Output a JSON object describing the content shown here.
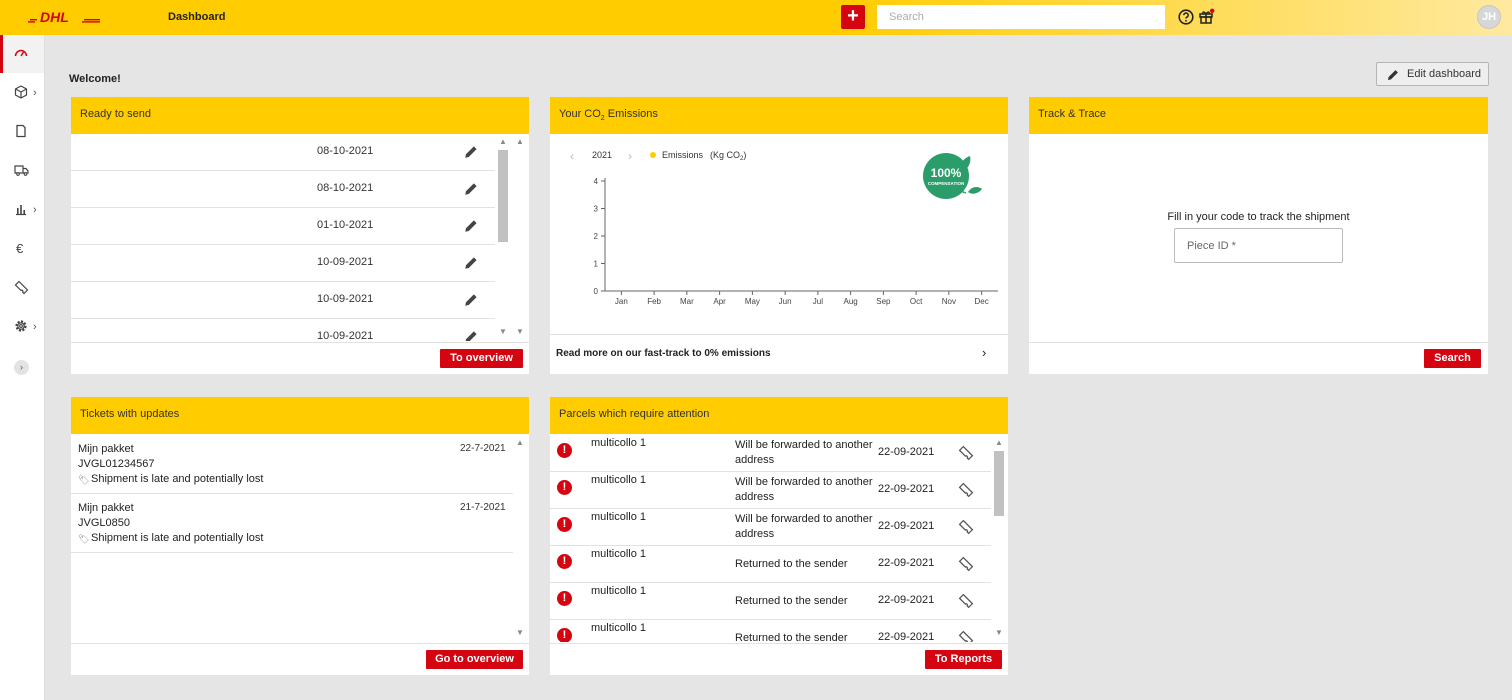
{
  "header": {
    "brand": "DHL",
    "page_title": "Dashboard",
    "search_placeholder": "Search",
    "avatar_initials": "JH",
    "accent_color": "#ffcc00",
    "brand_red": "#d40511"
  },
  "sidebar": {
    "items": [
      {
        "icon": "dashboard-icon",
        "has_chevron": false,
        "active": true
      },
      {
        "icon": "package-icon",
        "has_chevron": true
      },
      {
        "icon": "document-icon",
        "has_chevron": false
      },
      {
        "icon": "truck-icon",
        "has_chevron": false
      },
      {
        "icon": "bar-chart-icon",
        "has_chevron": true
      },
      {
        "icon": "euro-icon",
        "has_chevron": false
      },
      {
        "icon": "ticket-icon",
        "has_chevron": false
      },
      {
        "icon": "gear-icon",
        "has_chevron": true
      }
    ]
  },
  "welcome": "Welcome!",
  "edit_dashboard": "Edit dashboard",
  "ready_to_send": {
    "title": "Ready to send",
    "rows": [
      "08-10-2021",
      "08-10-2021",
      "01-10-2021",
      "10-09-2021",
      "10-09-2021",
      "10-09-2021"
    ],
    "button": "To overview"
  },
  "co2": {
    "title_pre": "Your CO",
    "title_sub": "2",
    "title_post": " Emissions",
    "year": "2021",
    "legend_label": "Emissions",
    "legend_unit_pre": "(Kg CO",
    "legend_unit_sub": "2",
    "legend_unit_post": ")",
    "badge_big": "100%",
    "badge_small": "COMPENSATION",
    "link": "Read more on our fast-track to 0% emissions"
  },
  "chart_data": {
    "type": "line",
    "categories": [
      "Jan",
      "Feb",
      "Mar",
      "Apr",
      "May",
      "Jun",
      "Jul",
      "Aug",
      "Sep",
      "Oct",
      "Nov",
      "Dec"
    ],
    "series": [
      {
        "name": "Emissions",
        "values": [
          0,
          0,
          0,
          0,
          0,
          0,
          0,
          0,
          0,
          0,
          0,
          0
        ]
      }
    ],
    "yticks": [
      "0",
      "1",
      "2",
      "3",
      "4"
    ],
    "ylim": [
      0,
      4
    ],
    "title": "",
    "xlabel": "",
    "ylabel": "",
    "legend": "top-left",
    "color": "#ffcc00"
  },
  "track": {
    "title": "Track & Trace",
    "instruction": "Fill in your code to track the shipment",
    "input_placeholder": "Piece ID *",
    "button": "Search"
  },
  "tickets": {
    "title": "Tickets with updates",
    "items": [
      {
        "name": "Mijn pakket",
        "code": "JVGL01234567",
        "status": "Shipment is late and potentially lost",
        "date": "22-7-2021"
      },
      {
        "name": "Mijn pakket",
        "code": "JVGL0850",
        "status": "Shipment is late and potentially lost",
        "date": "21-7-2021"
      }
    ],
    "button": "Go to overview"
  },
  "parcels": {
    "title": "Parcels which require attention",
    "rows": [
      {
        "name": "multicollo 1",
        "status": "Will be forwarded to another address",
        "date": "22-09-2021"
      },
      {
        "name": "multicollo 1",
        "status": "Will be forwarded to another address",
        "date": "22-09-2021"
      },
      {
        "name": "multicollo 1",
        "status": "Will be forwarded to another address",
        "date": "22-09-2021"
      },
      {
        "name": "multicollo 1",
        "status": "Returned to the sender",
        "date": "22-09-2021"
      },
      {
        "name": "multicollo 1",
        "status": "Returned to the sender",
        "date": "22-09-2021"
      },
      {
        "name": "multicollo 1",
        "status": "Returned to the sender",
        "date": "22-09-2021"
      }
    ],
    "alert_glyph": "!",
    "button": "To Reports"
  }
}
